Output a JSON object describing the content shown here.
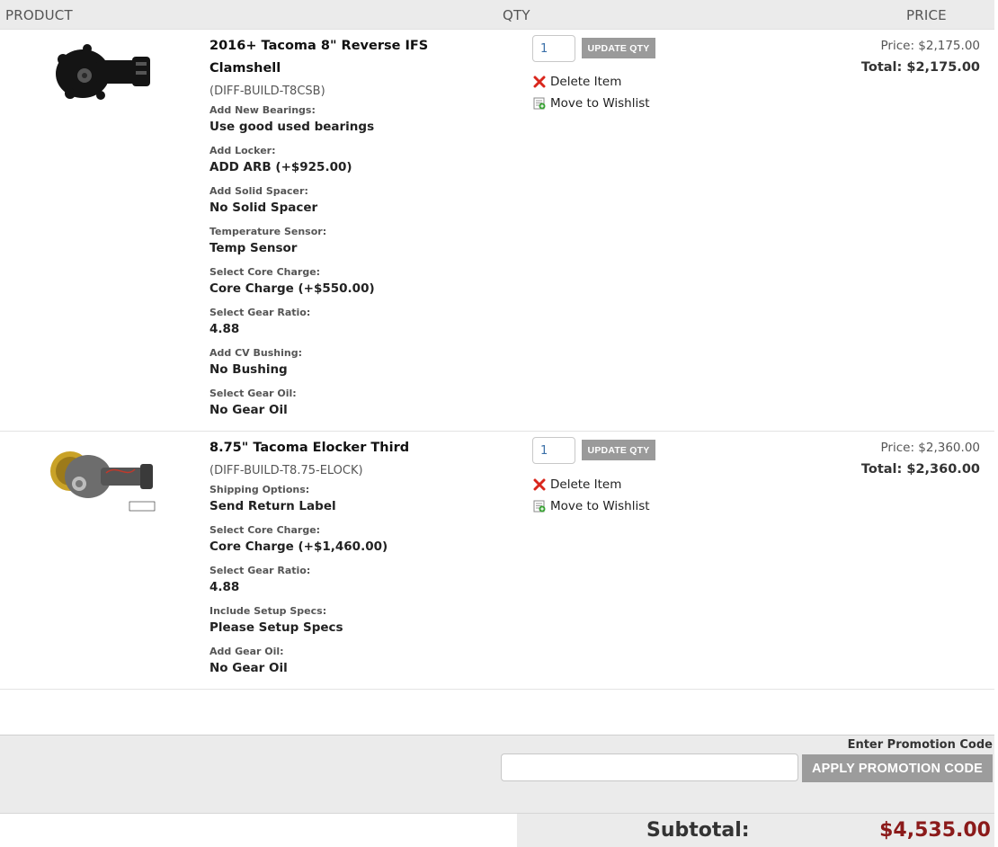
{
  "header": {
    "product": "PRODUCT",
    "qty": "QTY",
    "price": "PRICE"
  },
  "items": [
    {
      "name": "2016+ Tacoma 8\" Reverse IFS Clamshell",
      "sku": "(DIFF-BUILD-T8CSB)",
      "options": [
        {
          "label": "Add New Bearings:",
          "value": "Use good used bearings"
        },
        {
          "label": "Add Locker:",
          "value": "ADD ARB (+$925.00)"
        },
        {
          "label": "Add Solid Spacer:",
          "value": "No Solid Spacer"
        },
        {
          "label": "Temperature Sensor:",
          "value": "Temp Sensor"
        },
        {
          "label": "Select Core Charge:",
          "value": "Core Charge (+$550.00)"
        },
        {
          "label": "Select Gear Ratio:",
          "value": "4.88"
        },
        {
          "label": "Add CV Bushing:",
          "value": "No Bushing"
        },
        {
          "label": "Select Gear Oil:",
          "value": "No Gear Oil"
        }
      ],
      "qty": "1",
      "update_label": "UPDATE QTY",
      "delete_label": "Delete Item",
      "wishlist_label": "Move to Wishlist",
      "price": "Price: $2,175.00",
      "total": "Total: $2,175.00"
    },
    {
      "name": "8.75\" Tacoma Elocker Third",
      "sku": "(DIFF-BUILD-T8.75-ELOCK)",
      "options": [
        {
          "label": "Shipping Options:",
          "value": "Send Return Label"
        },
        {
          "label": "Select Core Charge:",
          "value": "Core Charge (+$1,460.00)"
        },
        {
          "label": "Select Gear Ratio:",
          "value": "4.88"
        },
        {
          "label": "Include Setup Specs:",
          "value": "Please Setup Specs"
        },
        {
          "label": "Add Gear Oil:",
          "value": "No Gear Oil"
        }
      ],
      "qty": "1",
      "update_label": "UPDATE QTY",
      "delete_label": "Delete Item",
      "wishlist_label": "Move to Wishlist",
      "price": "Price: $2,360.00",
      "total": "Total: $2,360.00"
    }
  ],
  "promo": {
    "label": "Enter Promotion Code",
    "value": "",
    "button": "APPLY PROMOTION CODE"
  },
  "subtotal": {
    "label": "Subtotal:",
    "value": "$4,535.00"
  },
  "colors": {
    "subtotal_value": "#8b1a1a",
    "button_bg": "#9a9a9a",
    "header_bg": "#ebebeb",
    "delete_icon": "#d9261c"
  },
  "icons": {
    "delete": "red-x-icon",
    "wishlist": "move-to-wishlist-icon"
  }
}
